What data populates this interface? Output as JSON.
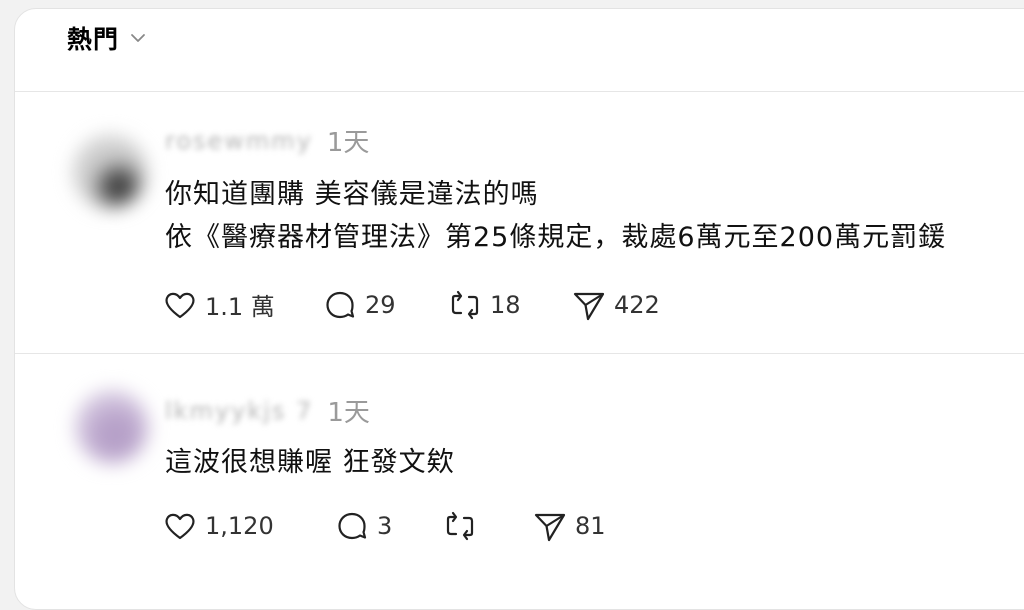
{
  "header": {
    "feed_title": "熱門"
  },
  "posts": [
    {
      "username": "rosewmmy",
      "time": "1天",
      "lines": [
        "你知道團購 美容儀是違法的嗎",
        "依《醫療器材管理法》第25條規定，裁處6萬元至200萬元罰鍰"
      ],
      "likes": "1.1 萬",
      "replies": "29",
      "reposts": "18",
      "shares": "422"
    },
    {
      "username": "lkmyykjs 7",
      "time": "1天",
      "lines": [
        "這波很想賺喔 狂發文欸"
      ],
      "likes": "1,120",
      "replies": "3",
      "reposts": "",
      "shares": "81"
    }
  ]
}
